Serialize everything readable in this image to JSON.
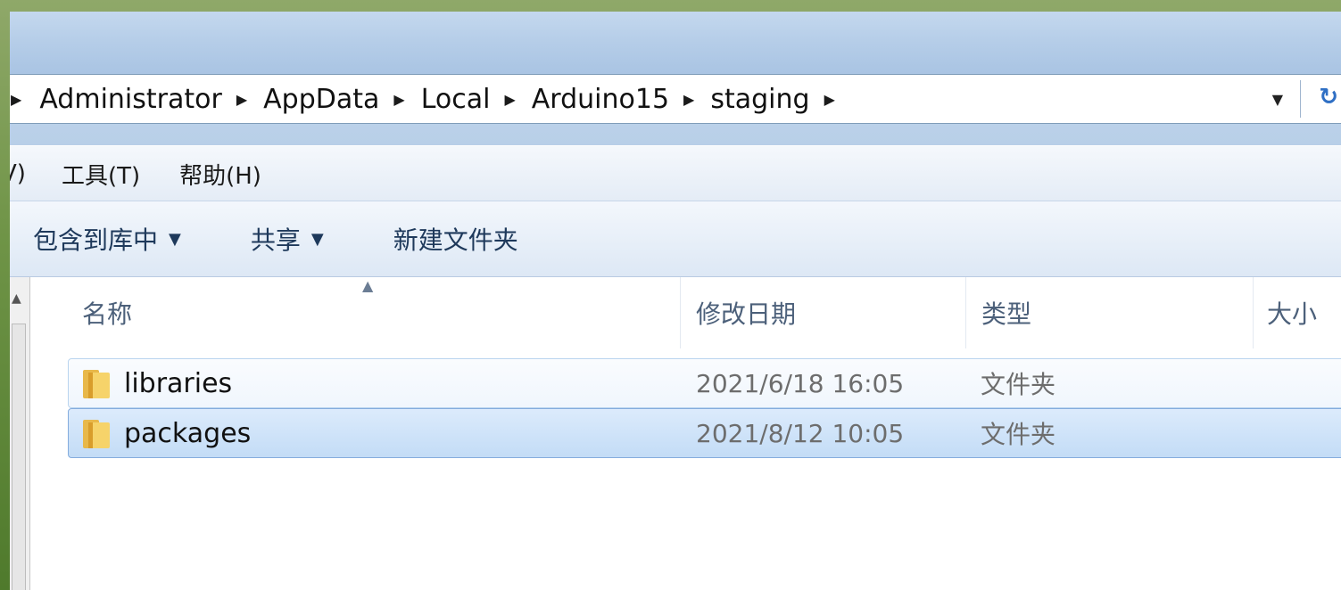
{
  "breadcrumb": [
    "Administrator",
    "AppData",
    "Local",
    "Arduino15",
    "staging"
  ],
  "menu": [
    "V)",
    "工具(T)",
    "帮助(H)"
  ],
  "toolbar": {
    "include_library": "包含到库中",
    "share": "共享",
    "new_folder": "新建文件夹"
  },
  "columns": {
    "name": "名称",
    "modified": "修改日期",
    "type": "类型",
    "size": "大小"
  },
  "files": [
    {
      "name": "libraries",
      "modified": "2021/6/18 16:05",
      "type": "文件夹"
    },
    {
      "name": "packages",
      "modified": "2021/8/12 10:05",
      "type": "文件夹"
    }
  ],
  "colors": {
    "selected_row": "#c3dcf6",
    "hover_row": "#f0f6fd",
    "title_bar": "#b5cde8",
    "desktop": "#6f9447"
  },
  "icons": {
    "crumb_separator": "triangle-right-icon",
    "address_dropdown": "chevron-down-icon",
    "refresh": "refresh-icon",
    "folder": "folder-icon",
    "sort": "sort-ascending-icon"
  }
}
